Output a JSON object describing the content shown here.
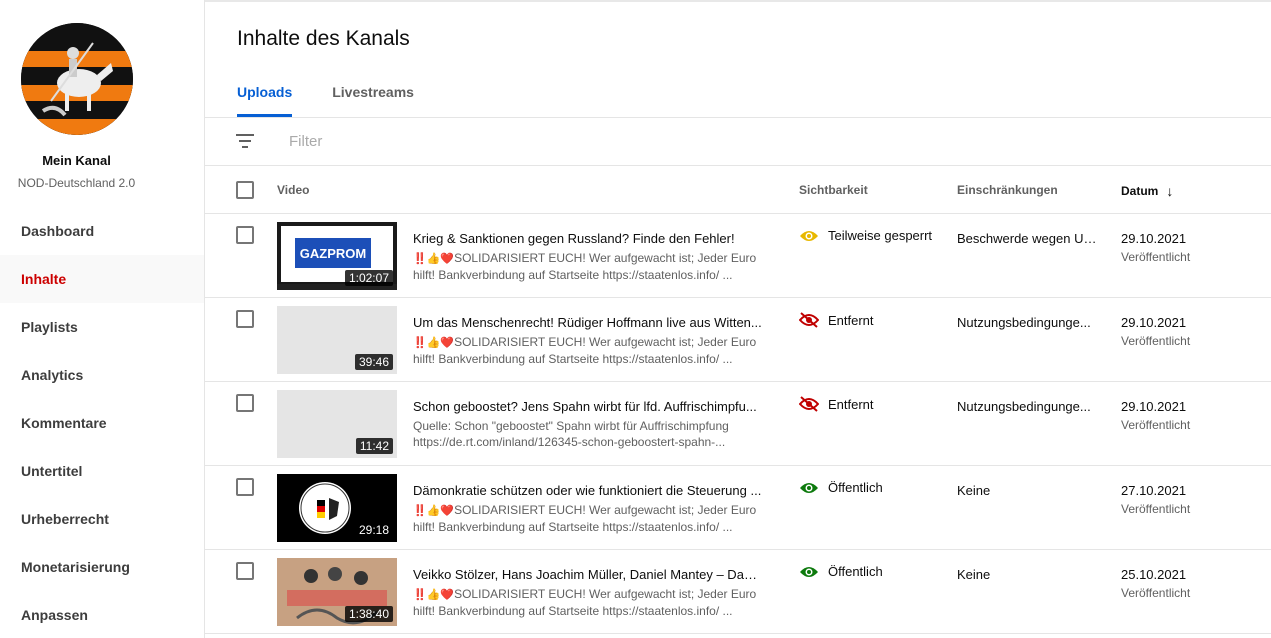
{
  "sidebar": {
    "channel_title": "Mein Kanal",
    "channel_name": "NOD-Deutschland 2.0",
    "items": [
      {
        "label": "Dashboard",
        "active": false
      },
      {
        "label": "Inhalte",
        "active": true
      },
      {
        "label": "Playlists",
        "active": false
      },
      {
        "label": "Analytics",
        "active": false
      },
      {
        "label": "Kommentare",
        "active": false
      },
      {
        "label": "Untertitel",
        "active": false
      },
      {
        "label": "Urheberrecht",
        "active": false
      },
      {
        "label": "Monetarisierung",
        "active": false
      },
      {
        "label": "Anpassen",
        "active": false
      }
    ]
  },
  "main": {
    "title": "Inhalte des Kanals",
    "tabs": [
      {
        "label": "Uploads",
        "active": true
      },
      {
        "label": "Livestreams",
        "active": false
      }
    ],
    "filter_placeholder": "Filter"
  },
  "table": {
    "headers": {
      "video": "Video",
      "visibility": "Sichtbarkeit",
      "restrictions": "Einschränkungen",
      "date": "Datum"
    },
    "rows": [
      {
        "title": "Krieg & Sanktionen gegen Russland? Finde den Fehler!",
        "desc_line1": "SOLIDARISIERT EUCH! Wer aufgewacht ist; Jeder Euro",
        "desc_line2": "hilft! Bankverbindung auf Startseite https://staatenlos.info/ ...",
        "duration": "1:02:07",
        "visibility": "Teilweise gesperrt",
        "visibility_icon": "eye-icon",
        "restriction": "Beschwerde wegen Ur...",
        "date": "29.10.2021",
        "status": "Veröffentlicht"
      },
      {
        "title": "Um das Menschenrecht! Rüdiger Hoffmann live aus Witten...",
        "desc_line1": "SOLIDARISIERT EUCH! Wer aufgewacht ist; Jeder Euro",
        "desc_line2": "hilft! Bankverbindung auf Startseite https://staatenlos.info/ ...",
        "duration": "39:46",
        "visibility": "Entfernt",
        "visibility_icon": "eye-off-icon",
        "restriction": "Nutzungsbedingunge...",
        "date": "29.10.2021",
        "status": "Veröffentlicht"
      },
      {
        "title": "Schon geboostet? Jens Spahn wirbt für lfd. Auffrischimpfu...",
        "desc_line1": "Quelle: Schon \"geboostet\" Spahn wirbt für Auffrischimpfung",
        "desc_line2": "https://de.rt.com/inland/126345-schon-geboostert-spahn-...",
        "duration": "11:42",
        "visibility": "Entfernt",
        "visibility_icon": "eye-off-icon",
        "restriction": "Nutzungsbedingunge...",
        "date": "29.10.2021",
        "status": "Veröffentlicht"
      },
      {
        "title": "Dämonkratie schützen oder wie funktioniert die Steuerung ...",
        "desc_line1": "SOLIDARISIERT EUCH! Wer aufgewacht ist; Jeder Euro",
        "desc_line2": "hilft! Bankverbindung auf Startseite https://staatenlos.info/ ...",
        "duration": "29:18",
        "visibility": "Öffentlich",
        "visibility_icon": "eye-icon",
        "restriction": "Keine",
        "date": "27.10.2021",
        "status": "Veröffentlicht"
      },
      {
        "title": "Veikko Stölzer, Hans Joachim Müller, Daniel Mantey – Das ...",
        "desc_line1": "SOLIDARISIERT EUCH! Wer aufgewacht ist; Jeder Euro",
        "desc_line2": "hilft! Bankverbindung auf Startseite https://staatenlos.info/ ...",
        "duration": "1:38:40",
        "visibility": "Öffentlich",
        "visibility_icon": "eye-icon",
        "restriction": "Keine",
        "date": "25.10.2021",
        "status": "Veröffentlicht"
      }
    ]
  },
  "thumbnails": {
    "gazprom_text": "GAZPROM"
  },
  "colors": {
    "accent_red": "#cc0000",
    "tab_blue": "#065fd4",
    "partial_yellow": "#e8b800",
    "removed_red": "#c00000",
    "public_green": "#0d7a0d"
  }
}
